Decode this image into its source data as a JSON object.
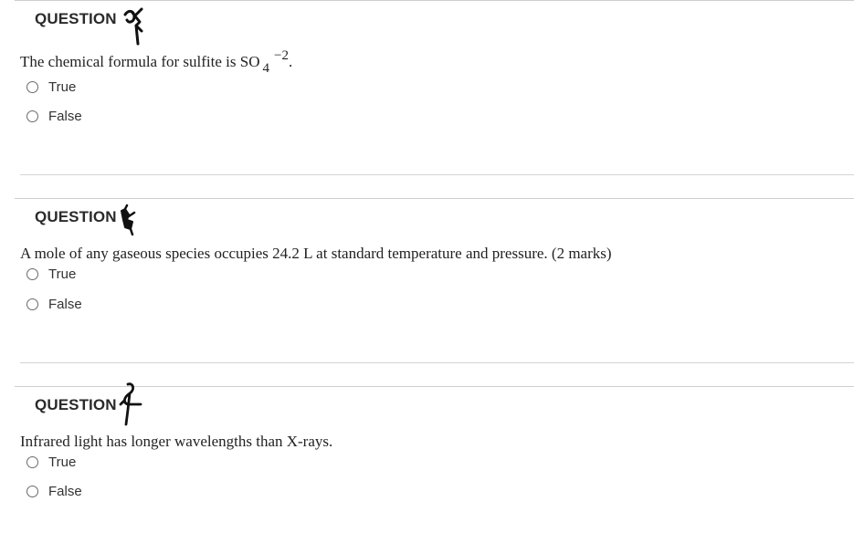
{
  "questions": [
    {
      "header": "QUESTION",
      "text": "The chemical formula for sulfite is SO",
      "subscript": "4",
      "superscript": "−2",
      "text_end": ".",
      "options": [
        "True",
        "False"
      ]
    },
    {
      "header": "QUESTION",
      "text": "A mole of any gaseous species occupies 24.2 L at standard temperature and pressure.  (2 marks)",
      "options": [
        "True",
        "False"
      ]
    },
    {
      "header": "QUESTION",
      "text": "Infrared light has longer wavelengths than X-rays.",
      "options": [
        "True",
        "False"
      ]
    }
  ]
}
